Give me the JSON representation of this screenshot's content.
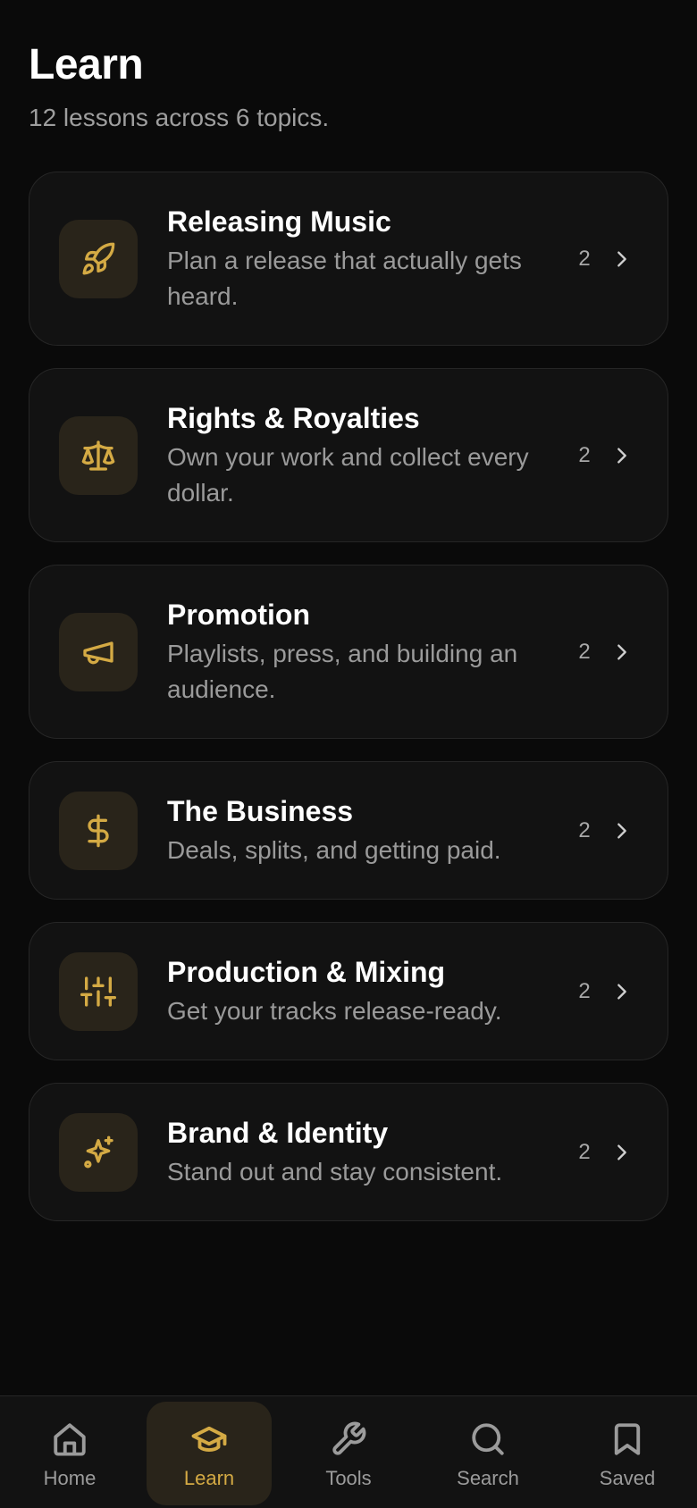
{
  "header": {
    "title": "Learn",
    "subtitle": "12 lessons across 6 topics."
  },
  "topics": [
    {
      "title": "Releasing Music",
      "description": "Plan a release that actually gets heard.",
      "count": "2",
      "icon": "rocket-icon"
    },
    {
      "title": "Rights & Royalties",
      "description": "Own your work and collect every dollar.",
      "count": "2",
      "icon": "scale-icon"
    },
    {
      "title": "Promotion",
      "description": "Playlists, press, and building an audience.",
      "count": "2",
      "icon": "megaphone-icon"
    },
    {
      "title": "The Business",
      "description": "Deals, splits, and getting paid.",
      "count": "2",
      "icon": "dollar-icon"
    },
    {
      "title": "Production & Mixing",
      "description": "Get your tracks release-ready.",
      "count": "2",
      "icon": "sliders-icon"
    },
    {
      "title": "Brand & Identity",
      "description": "Stand out and stay consistent.",
      "count": "2",
      "icon": "sparkles-icon"
    }
  ],
  "nav": {
    "items": [
      {
        "label": "Home",
        "icon": "home-icon",
        "active": false
      },
      {
        "label": "Learn",
        "icon": "graduation-cap-icon",
        "active": true
      },
      {
        "label": "Tools",
        "icon": "wrench-icon",
        "active": false
      },
      {
        "label": "Search",
        "icon": "search-icon",
        "active": false
      },
      {
        "label": "Saved",
        "icon": "bookmark-icon",
        "active": false
      }
    ]
  },
  "colors": {
    "accent": "#d4aa44",
    "background": "#0a0a0a",
    "card": "#121212",
    "icon_tile": "#29241a"
  }
}
